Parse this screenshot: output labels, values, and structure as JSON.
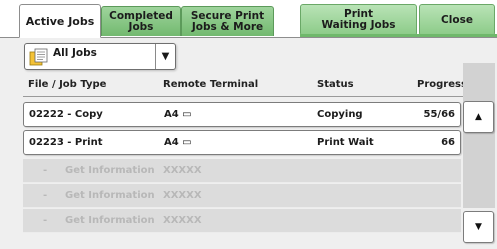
{
  "tabs": [
    {
      "label": "Active Jobs"
    },
    {
      "label": "Completed\nJobs"
    },
    {
      "label": "Secure Print\nJobs & More"
    },
    {
      "label": "Print\nWaiting Jobs"
    },
    {
      "label": "Close"
    }
  ],
  "filter": {
    "selected": "All Jobs"
  },
  "columns": {
    "file_job_type": "File / Job Type",
    "remote_terminal": "Remote Terminal",
    "status": "Status",
    "progress": "Progress"
  },
  "jobs": [
    {
      "file": "02222 - Copy",
      "terminal": "A4 ▭",
      "status": "Copying",
      "progress": "55/66"
    },
    {
      "file": "02223 - Print",
      "terminal": "A4 ▭",
      "status": "Print Wait",
      "progress": "66"
    }
  ],
  "placeholders": [
    {
      "dash": "-",
      "label": "Get Information",
      "terminal": "XXXXX"
    },
    {
      "dash": "-",
      "label": "Get Information",
      "terminal": "XXXXX"
    },
    {
      "dash": "-",
      "label": "Get Information",
      "terminal": "XXXXX"
    }
  ],
  "scroll": {
    "up_icon": "triangle-up",
    "down_icon": "triangle-down",
    "up_glyph": "▲",
    "down_glyph": "▼"
  },
  "colors": {
    "tab_green": "#72b96f",
    "panel_bg": "#efefef",
    "placeholder_bg": "#dcdcdc"
  }
}
